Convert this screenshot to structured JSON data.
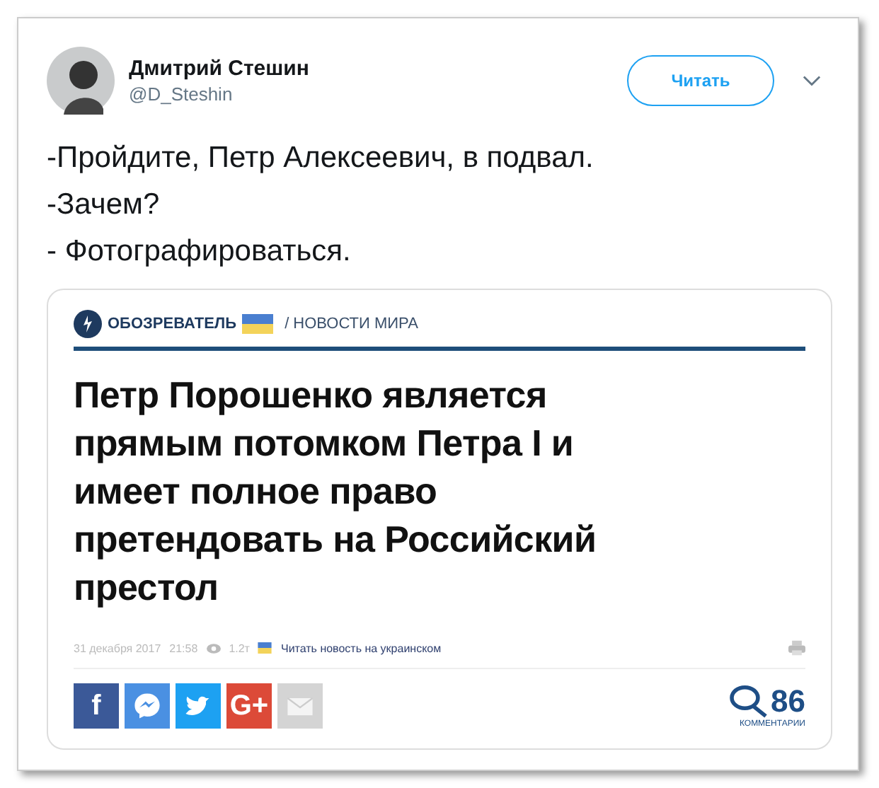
{
  "tweet": {
    "author": {
      "name": "Дмитрий Стешин",
      "handle": "@D_Steshin"
    },
    "follow_button": "Читать",
    "text_lines": [
      "-Пройдите, Петр Алексеевич, в подвал.",
      "-Зачем?",
      "- Фотографироваться."
    ],
    "embedded_screenshot": {
      "site": "ОБОЗРЕВАТЕЛЬ",
      "section": "/ НОВОСТИ МИРА",
      "headline": "Петр Порошенко является прямым потомком Петра I и имеет полное право претендовать на Российский престол",
      "meta": {
        "date": "31 декабря 2017",
        "time": "21:58",
        "views": "1.2т",
        "translate_link": "Читать новость на украинском"
      },
      "share_buttons": [
        {
          "kind": "facebook",
          "label": "f"
        },
        {
          "kind": "messenger"
        },
        {
          "kind": "twitter"
        },
        {
          "kind": "google",
          "label": "G+"
        },
        {
          "kind": "email"
        }
      ],
      "comments": {
        "count": "86",
        "label": "КОММЕНТАРИИ"
      }
    }
  }
}
